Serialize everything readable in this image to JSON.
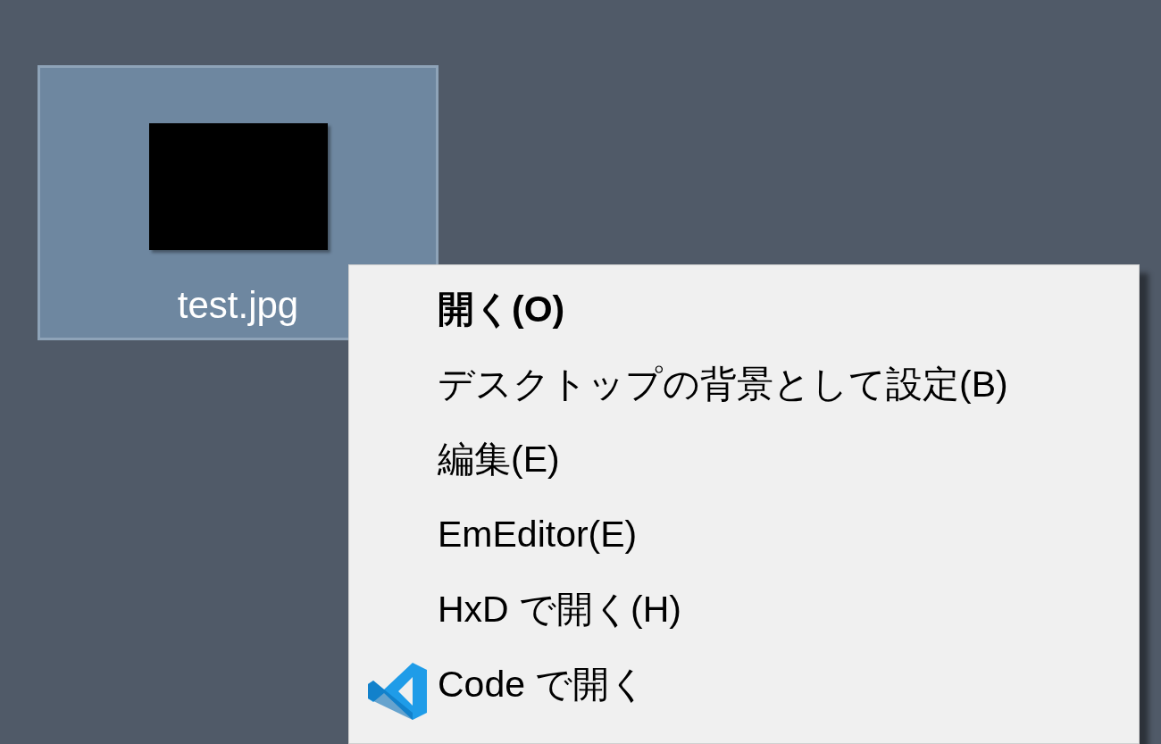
{
  "desktop_icons": [
    {
      "label": "test.jpg",
      "selected": true
    }
  ],
  "context_menu": {
    "items": [
      {
        "label": "開く(O)",
        "kind": "plain",
        "default": true
      },
      {
        "label": "デスクトップの背景として設定(B)",
        "kind": "plain",
        "default": false
      },
      {
        "label": "編集(E)",
        "kind": "plain",
        "default": false
      },
      {
        "label": "EmEditor(E)",
        "kind": "plain",
        "default": false
      },
      {
        "label": "HxD で開く(H)",
        "kind": "plain",
        "default": false
      },
      {
        "label": "Code で開く",
        "kind": "app",
        "default": false
      }
    ]
  }
}
